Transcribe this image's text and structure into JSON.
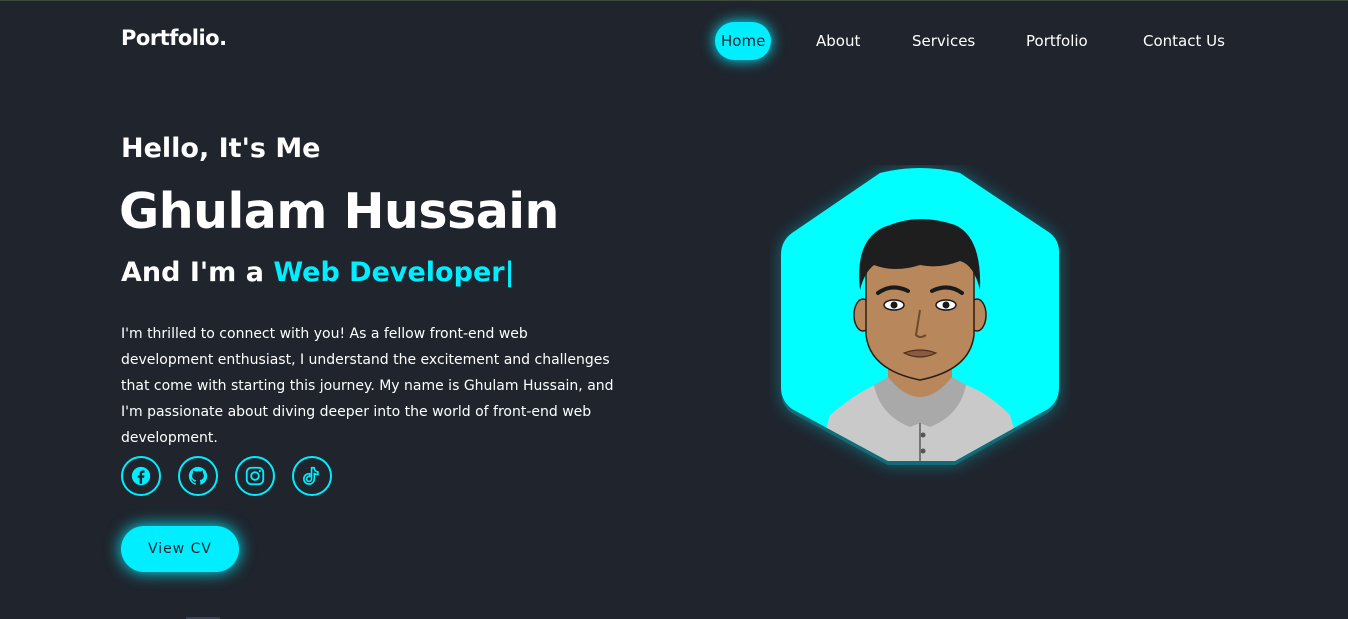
{
  "brand": {
    "logo": "Portfolio."
  },
  "nav": {
    "items": [
      {
        "label": "Home",
        "active": true
      },
      {
        "label": "About",
        "active": false
      },
      {
        "label": "Services",
        "active": false
      },
      {
        "label": "Portfolio",
        "active": false
      },
      {
        "label": "Contact Us",
        "active": false
      }
    ]
  },
  "hero": {
    "greeting": "Hello, It's Me",
    "name": "Ghulam Hussain",
    "role_prefix": "And I'm a ",
    "role_highlight": "Web Developer",
    "cursor": "|",
    "description": "I'm thrilled to connect with you! As a fellow front-end web development enthusiast, I understand the excitement and challenges that come with starting this journey. My name is Ghulam Hussain, and I'm passionate about diving deeper into the world of front-end web development.",
    "cv_button": "View CV"
  },
  "socials": [
    {
      "icon": "facebook-icon"
    },
    {
      "icon": "github-icon"
    },
    {
      "icon": "instagram-icon"
    },
    {
      "icon": "tiktok-icon"
    }
  ],
  "colors": {
    "background": "#1f242d",
    "accent": "#00eeff",
    "text": "#ffffff"
  }
}
